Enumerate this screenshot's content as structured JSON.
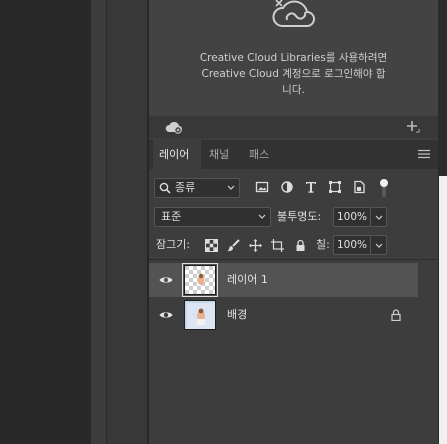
{
  "libraries": {
    "message_line1": "Creative Cloud Libraries를 사용하려면",
    "message_line2": "Creative Cloud 계정으로 로그인해야 합",
    "message_line3": "니다."
  },
  "tabs": {
    "layers": "레이어",
    "channels": "채널",
    "paths": "패스"
  },
  "filter": {
    "kind_label": "종류",
    "icons": [
      "image-filter-icon",
      "adjustment-filter-icon",
      "type-filter-icon",
      "shape-filter-icon",
      "smart-object-filter-icon"
    ]
  },
  "blend": {
    "mode": "표준",
    "opacity_label": "불투명도:",
    "opacity_value": "100%"
  },
  "lock": {
    "label": "잠그기:",
    "fill_label": "칠:",
    "fill_value": "100%"
  },
  "layers": [
    {
      "name": "레이어 1",
      "selected": true,
      "visible": true,
      "locked": false
    },
    {
      "name": "배경",
      "selected": false,
      "visible": true,
      "locked": true
    }
  ],
  "colors": {
    "panel_bg": "#3d3d3d",
    "selected_row": "#535353",
    "tab_bar": "#323232"
  }
}
